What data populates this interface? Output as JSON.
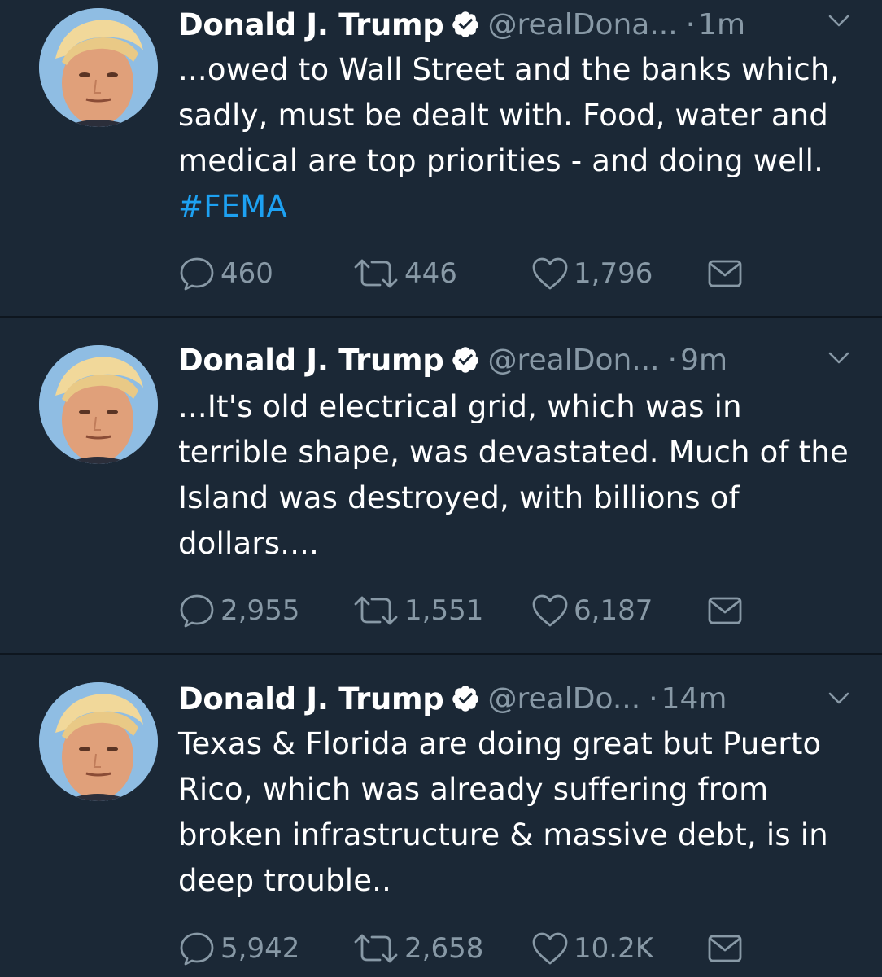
{
  "tweets": [
    {
      "name": "Donald J. Trump",
      "handle": "@realDona...",
      "dot": "·",
      "time": "1m",
      "text": "...owed to Wall Street and the banks which, sadly, must be dealt with. Food, water and medical are top priorities - and doing well.",
      "hashtag": "#FEMA",
      "replies": "460",
      "retweets": "446",
      "likes": "1,796"
    },
    {
      "name": "Donald J. Trump",
      "handle": "@realDon...",
      "dot": "·",
      "time": "9m",
      "text": "...It's old electrical grid, which was in terrible shape, was devastated. Much of the Island was destroyed, with billions of dollars....",
      "hashtag": "",
      "replies": "2,955",
      "retweets": "1,551",
      "likes": "6,187"
    },
    {
      "name": "Donald J. Trump",
      "handle": "@realDo...",
      "dot": "·",
      "time": "14m",
      "text": "Texas & Florida are doing great but Puerto Rico, which was already suffering from broken infrastructure & massive debt, is in deep trouble..",
      "hashtag": "",
      "replies": "5,942",
      "retweets": "2,658",
      "likes": "10.2K"
    }
  ],
  "icons": {
    "verified": "verified-badge-icon",
    "caret": "chevron-down-icon",
    "reply": "reply-icon",
    "retweet": "retweet-icon",
    "like": "heart-icon",
    "dm": "envelope-icon"
  },
  "colors": {
    "background": "#1b2836",
    "text": "#ffffff",
    "muted": "#8899a6",
    "link": "#1da1f2",
    "divider": "#0e161f"
  }
}
